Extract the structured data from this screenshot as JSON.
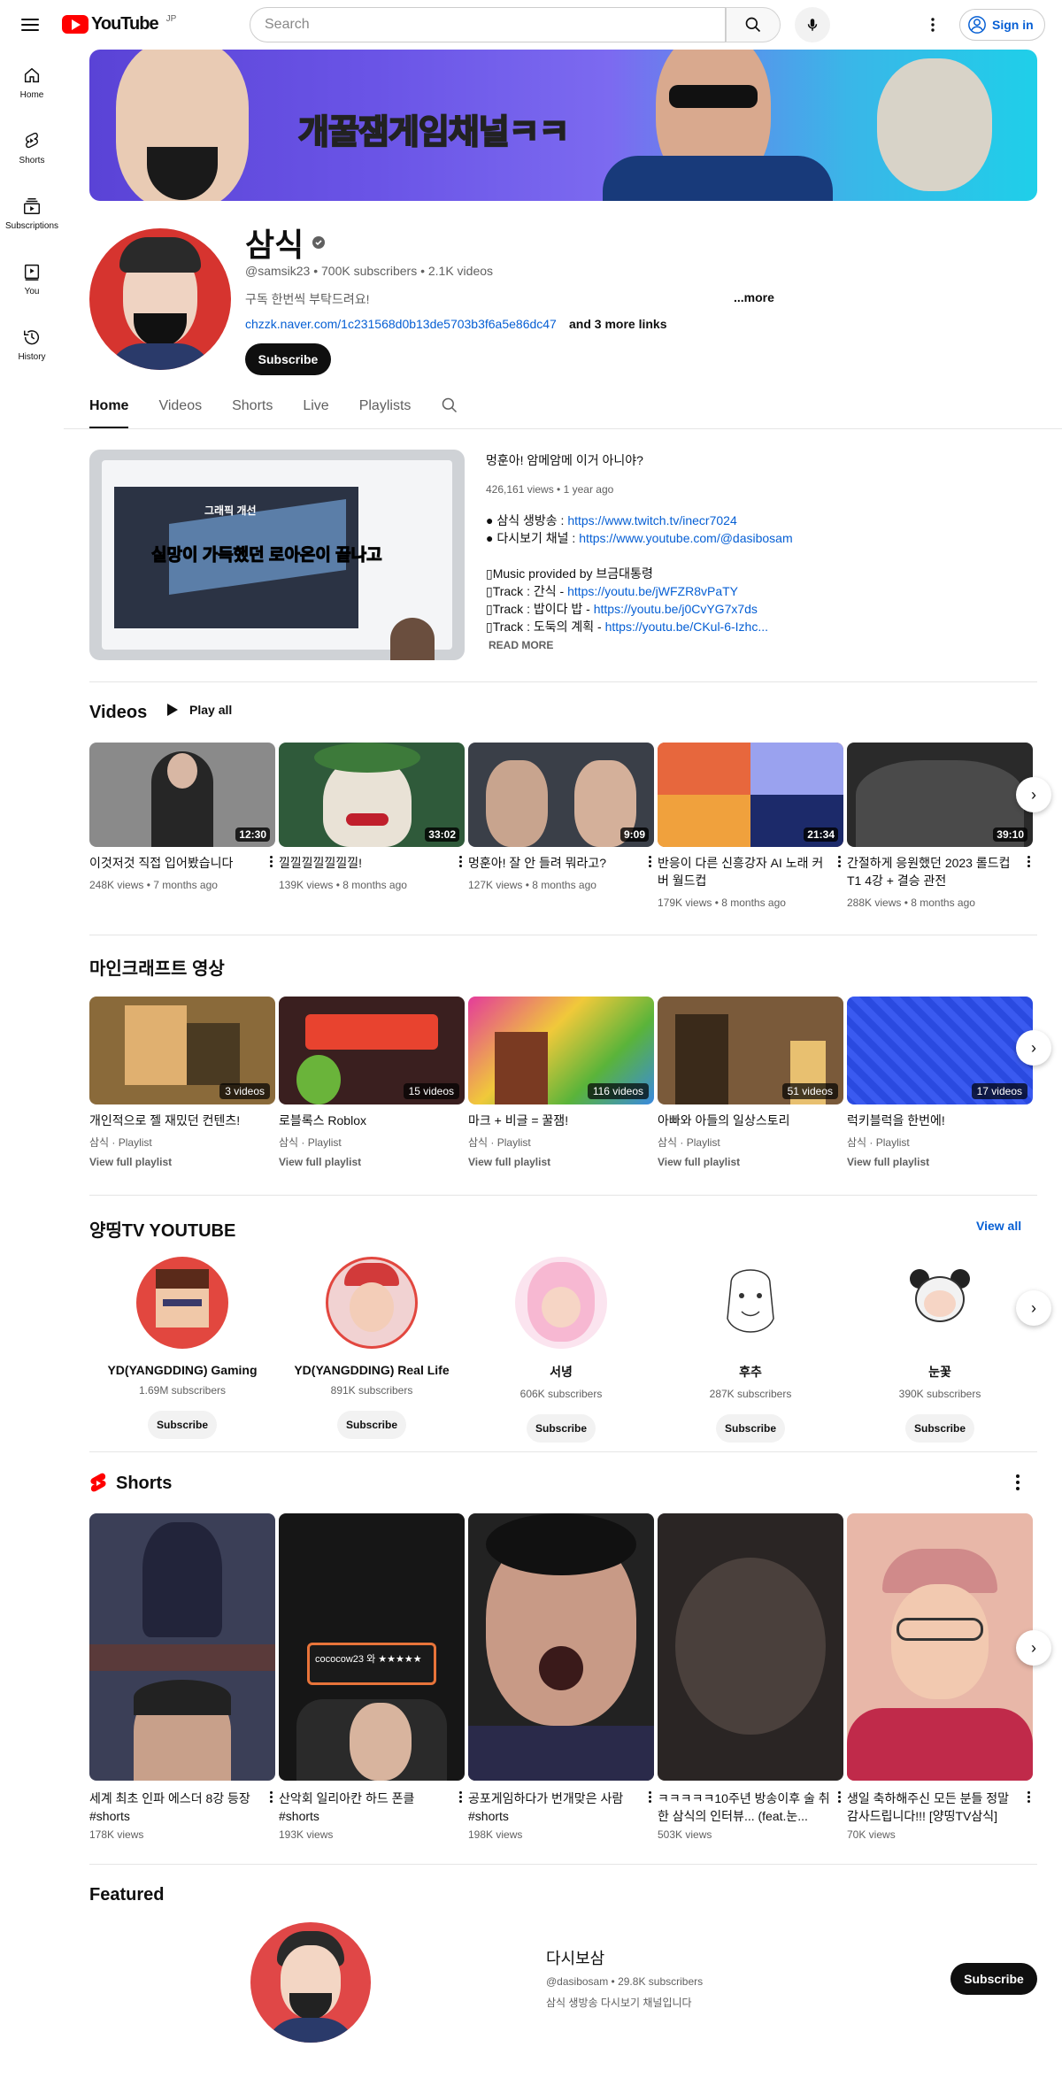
{
  "header": {
    "logo_text": "YouTube",
    "region": "JP",
    "search_placeholder": "Search",
    "signin_label": "Sign in"
  },
  "sidebar": {
    "items": [
      {
        "label": "Home",
        "icon": "home-icon"
      },
      {
        "label": "Shorts",
        "icon": "shorts-icon"
      },
      {
        "label": "Subscriptions",
        "icon": "subscriptions-icon"
      },
      {
        "label": "You",
        "icon": "you-icon"
      },
      {
        "label": "History",
        "icon": "history-icon"
      }
    ]
  },
  "banner": {
    "text": "개꿀잼게임채널ㅋㅋ"
  },
  "channel": {
    "name": "삼식",
    "meta": "@samsik23 • 700K subscribers • 2.1K videos",
    "description": "구독 한번씩 부탁드려요!",
    "more_label": "...more",
    "link": "chzzk.naver.com/1c231568d0b13de5703b3f6a5e86dc47",
    "more_links": "and 3 more links",
    "subscribe_label": "Subscribe"
  },
  "tabs": [
    {
      "label": "Home",
      "active": true
    },
    {
      "label": "Videos",
      "active": false
    },
    {
      "label": "Shorts",
      "active": false
    },
    {
      "label": "Live",
      "active": false
    },
    {
      "label": "Playlists",
      "active": false
    }
  ],
  "featured_video": {
    "title": "멍훈아! 암메암메 이거 아니야?",
    "meta": "426,161 views • 1 year ago",
    "thumb_caption_top": "그래픽 개선",
    "thumb_caption": "실망이 가득했던 로아온이 끝나고",
    "desc_lines": [
      {
        "prefix": "● 삼식 생방송 : ",
        "link": "https://www.twitch.tv/inecr7024"
      },
      {
        "prefix": "● 다시보기 채널 : ",
        "link": "https://www.youtube.com/@dasibosam"
      },
      {
        "prefix": "",
        "link": ""
      },
      {
        "prefix": "▯Music provided by 브금대통령",
        "link": ""
      },
      {
        "prefix": "▯Track : 간식 - ",
        "link": "https://youtu.be/jWFZR8vPaTY"
      },
      {
        "prefix": "▯Track : 밥이다 밥 - ",
        "link": "https://youtu.be/j0CvYG7x7ds"
      },
      {
        "prefix": "▯Track : 도둑의 계획 - ",
        "link": "https://youtu.be/CKul-6-Izhc..."
      }
    ],
    "read_more": "READ MORE"
  },
  "videos_section": {
    "title": "Videos",
    "play_all": "Play all",
    "items": [
      {
        "title": "이것저것 직접 입어봤습니다",
        "meta": "248K views • 7 months ago",
        "duration": "12:30",
        "color": "#6b6b6b"
      },
      {
        "title": "낄낄낄낄낄낄낄!",
        "meta": "139K views • 8 months ago",
        "duration": "33:02",
        "color": "#2f5a3a"
      },
      {
        "title": "멍훈아! 잘 안 들려 뭐라고?",
        "meta": "127K views • 8 months ago",
        "duration": "9:09",
        "color": "#3a3f48"
      },
      {
        "title": "반응이 다른 신흥강자 AI 노래 커버 월드컵",
        "meta": "179K views • 8 months ago",
        "duration": "21:34",
        "color": "#d9542e"
      },
      {
        "title": "간절하게 응원했던 2023 롤드컵 T1 4강 + 결승 관전",
        "meta": "288K views • 8 months ago",
        "duration": "39:10",
        "color": "#2a2a2a"
      }
    ]
  },
  "minecraft_section": {
    "title": "마인크래프트 영상",
    "items": [
      {
        "title": "개인적으로 젤 재밌던 컨텐츠!",
        "channel": "삼식 · Playlist",
        "count": "3 videos",
        "link": "View full playlist",
        "color": "#8a6a3a"
      },
      {
        "title": "로블록스 Roblox",
        "channel": "삼식 · Playlist",
        "count": "15 videos",
        "link": "View full playlist",
        "color": "#3a1f1f"
      },
      {
        "title": "마크 + 비글 = 꿀잼!",
        "channel": "삼식 · Playlist",
        "count": "116 videos",
        "link": "View full playlist",
        "color": "#5ab43a"
      },
      {
        "title": "아빠와 아들의 일상스토리",
        "channel": "삼식 · Playlist",
        "count": "51 videos",
        "link": "View full playlist",
        "color": "#7a5a3a"
      },
      {
        "title": "럭키블럭을 한번에!",
        "channel": "삼식 · Playlist",
        "count": "17 videos",
        "link": "View full playlist",
        "color": "#2a4ae0"
      }
    ]
  },
  "channels_section": {
    "title": "양띵TV YOUTUBE",
    "view_all": "View all",
    "items": [
      {
        "name": "YD(YANGDDING) Gaming",
        "subs": "1.69M subscribers",
        "button": "Subscribe",
        "color": "#e2473f"
      },
      {
        "name": "YD(YANGDDING) Real Life",
        "subs": "891K subscribers",
        "button": "Subscribe",
        "color": "#f1a0a0"
      },
      {
        "name": "서녕",
        "subs": "606K subscribers",
        "button": "Subscribe",
        "color": "#f7b8d2"
      },
      {
        "name": "후추",
        "subs": "287K subscribers",
        "button": "Subscribe",
        "color": "#ffffff"
      },
      {
        "name": "눈꽃",
        "subs": "390K subscribers",
        "button": "Subscribe",
        "color": "#ffffff"
      }
    ]
  },
  "shorts_section": {
    "title": "Shorts",
    "items": [
      {
        "title": "세계 최초 인파 에스더 8강 등장 #shorts",
        "views": "178K views",
        "color": "#3b3f57"
      },
      {
        "title": "산악회 일리아칸 하드 폰클 #shorts",
        "views": "193K views",
        "color": "#161616",
        "overlay": "cococow23 와 ★★★★★"
      },
      {
        "title": "공포게임하다가 번개맞은 사람 #shorts",
        "views": "198K views",
        "color": "#222222"
      },
      {
        "title": "ㅋㅋㅋㅋㅋ10주년 방송이후 술 취한 삼식의 인터뷰... (feat.눈...",
        "views": "503K views",
        "color": "#3a3230"
      },
      {
        "title": "생일 축하해주신 모든 분들 정말 감사드립니다!!! [양띵TV삼식]",
        "views": "70K views",
        "color": "#e8b7a8"
      }
    ]
  },
  "featured_channel": {
    "section_title": "Featured",
    "name": "다시보삼",
    "meta": "@dasibosam • 29.8K subscribers",
    "description": "삼식 생방송 다시보기 채널입니다",
    "button": "Subscribe"
  }
}
